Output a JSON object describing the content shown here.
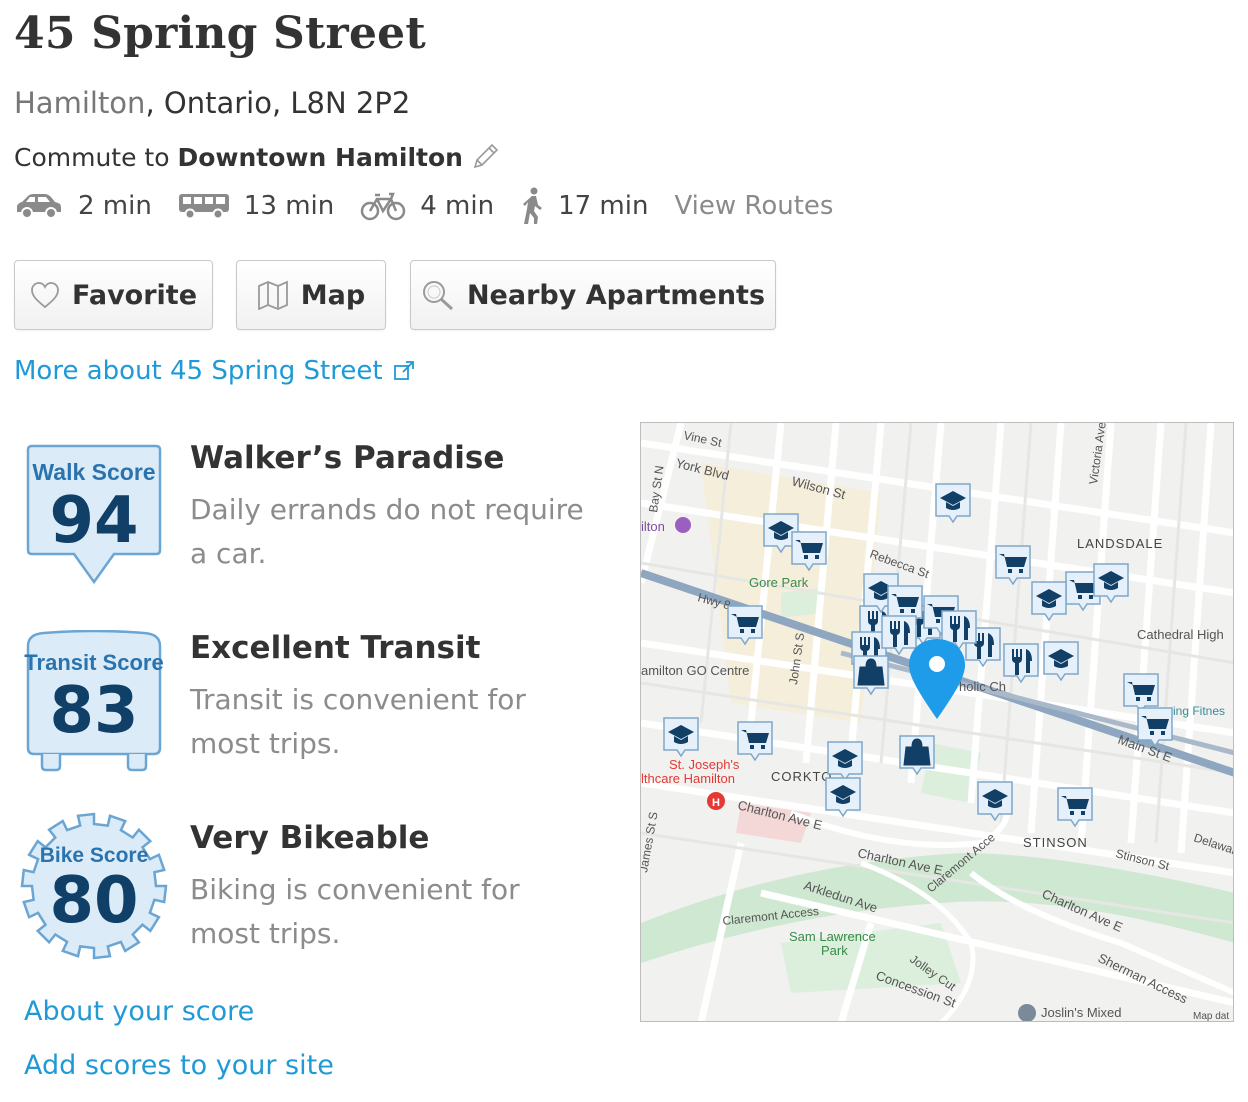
{
  "header": {
    "title": "45 Spring Street",
    "city": "Hamilton",
    "region": ", Ontario, L8N 2P2",
    "commute_prefix": "Commute to ",
    "commute_destination": "Downtown Hamilton"
  },
  "commute_modes": [
    {
      "icon": "car-icon",
      "time": "2 min"
    },
    {
      "icon": "bus-icon",
      "time": "13 min"
    },
    {
      "icon": "bike-icon",
      "time": "4 min"
    },
    {
      "icon": "walk-icon",
      "time": "17 min"
    }
  ],
  "view_routes": "View Routes",
  "buttons": {
    "favorite": "Favorite",
    "map": "Map",
    "nearby": "Nearby Apartments"
  },
  "more_link": "More about 45 Spring Street",
  "scores": [
    {
      "label": "Walk Score",
      "value": "94",
      "title": "Walker’s Paradise",
      "description": "Daily errands do not require a car."
    },
    {
      "label": "Transit Score",
      "value": "83",
      "title": "Excellent Transit",
      "description": "Transit is convenient for most trips."
    },
    {
      "label": "Bike Score",
      "value": "80",
      "title": "Very Bikeable",
      "description": "Biking is convenient for most trips."
    }
  ],
  "links": {
    "about": "About your score",
    "add": "Add scores to your site"
  },
  "map": {
    "labels": {
      "vine": "Vine St",
      "york": "York Blvd",
      "wilson": "Wilson St",
      "bay": "Bay St N",
      "hamilton": "ilton",
      "gore": "Gore Park",
      "hwy8": "Hwy 8",
      "go": "amilton GO Centre",
      "landsdale": "LANDSDALE",
      "cathedral": "Cathedral High",
      "corktown": "CORKTO",
      "stjoseph1": "St. Joseph's",
      "stjoseph2": "lthcare Hamilton",
      "charlton1": "Charlton Ave E",
      "charlton2": "Charlton Ave E",
      "charlton3": "Charlton Ave E",
      "stinson": "STINSON",
      "stinsonst": "Stinson St",
      "arkledun": "Arkledun Ave",
      "claremont": "Claremont Access",
      "claremont2": "Claremont Acce",
      "samlawrence1": "Sam Lawrence",
      "samlawrence2": "Park",
      "jolley": "Jolley Cut",
      "concession": "Concession St",
      "sherman": "Sherman Access",
      "joslin": "Joslin's Mixed",
      "mapdata": "Map dat",
      "main": "Main St E",
      "john": "John St S",
      "james": "James St S",
      "victoria": "Victoria Ave N",
      "fitness": "ing Fitnes",
      "delaware": "Delawar",
      "catholic": "holic Ch",
      "rebecca": "Rebecca St"
    }
  },
  "colors": {
    "link": "#1f9ad6",
    "badge_fill": "#dcebf8",
    "badge_stroke": "#6aa5d3",
    "badge_number": "#103f68",
    "map_pin": "#1e9be9"
  }
}
